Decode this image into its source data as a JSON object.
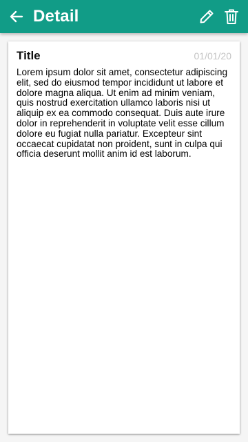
{
  "appbar": {
    "title": "Detail",
    "back_icon": "arrow-left-icon",
    "edit_icon": "pencil-icon",
    "delete_icon": "trash-icon",
    "color": "#119c87"
  },
  "note": {
    "title": "Title",
    "date": "01/01/20",
    "body": "Lorem ipsum dolor sit amet, consectetur adipiscing elit, sed do eiusmod tempor incididunt ut labore et dolore magna aliqua. Ut enim ad minim veniam, quis nostrud exercitation ullamco laboris nisi ut aliquip ex ea commodo consequat. Duis aute irure dolor in reprehenderit in voluptate velit esse cillum dolore eu fugiat nulla pariatur. Excepteur sint occaecat cupidatat non proident, sunt in culpa qui officia deserunt mollit anim id est laborum."
  }
}
